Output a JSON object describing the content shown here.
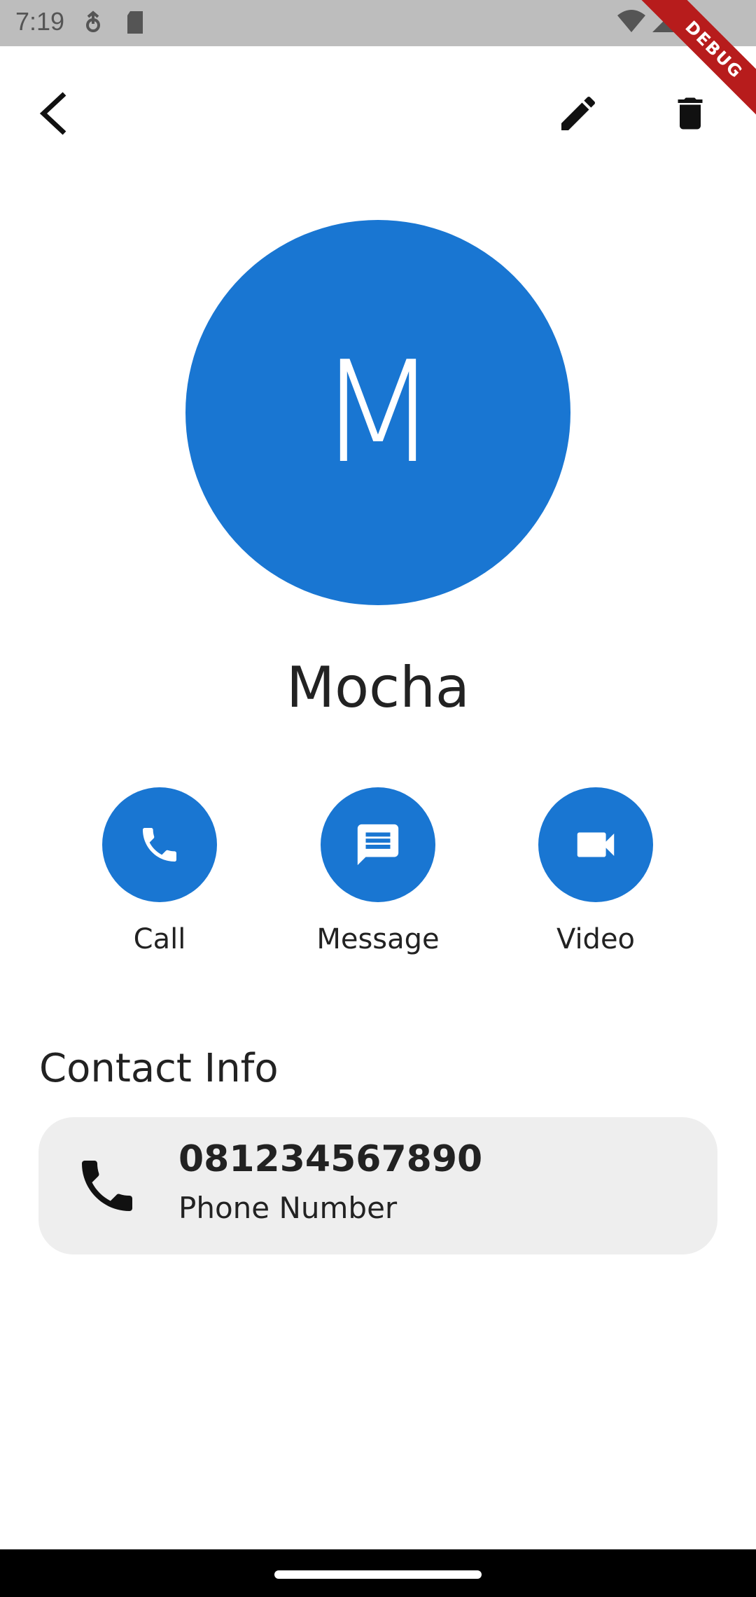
{
  "status_bar": {
    "time": "7:19"
  },
  "debug_banner": {
    "label": "DEBUG"
  },
  "contact": {
    "initial": "M",
    "name": "Mocha"
  },
  "actions": [
    {
      "label": "Call",
      "icon": "phone-icon"
    },
    {
      "label": "Message",
      "icon": "message-icon"
    },
    {
      "label": "Video",
      "icon": "videocam-icon"
    }
  ],
  "contact_info": {
    "title": "Contact Info",
    "items": [
      {
        "value": "081234567890",
        "label": "Phone Number",
        "icon": "phone-icon"
      }
    ]
  },
  "colors": {
    "accent": "#1976d2",
    "card": "#eeeeee",
    "status_bar": "#bdbdbd"
  }
}
